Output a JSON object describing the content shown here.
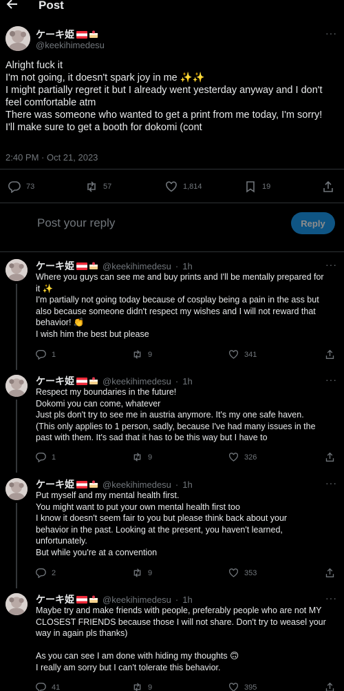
{
  "header": {
    "title": "Post"
  },
  "main": {
    "display_name": "ケーキ姫",
    "handle": "@keekihimedesu",
    "lines": [
      "Alright fuck it",
      "I'm not going, it doesn't spark joy in me ✨✨",
      "I might partially regret it but I already went yesterday anyway and I don't",
      "feel comfortable atm",
      "There was someone who wanted to get a print from me today, I'm sorry!",
      "I'll make sure to get a booth for dokomi (cont"
    ],
    "timestamp": "2:40 PM · Oct 21, 2023",
    "replies": "73",
    "reposts": "57",
    "likes": "1,814",
    "bookmarks": "19"
  },
  "reply_box": {
    "placeholder": "Post your reply",
    "button": "Reply"
  },
  "thread": [
    {
      "display_name": "ケーキ姫",
      "handle": "@keekihimedesu",
      "time": "1h",
      "lines": [
        "Where you guys can see me and buy prints and I'll be mentally prepared for",
        "it ✨",
        "I'm partially not going today because of cosplay being a pain in the ass but",
        "also because someone didn't respect my wishes and I will not reward that",
        "behavior! 👏",
        "I wish him the best but please"
      ],
      "replies": "1",
      "reposts": "9",
      "likes": "341"
    },
    {
      "display_name": "ケーキ姫",
      "handle": "@keekihimedesu",
      "time": "1h",
      "lines": [
        "Respect my boundaries in the future!",
        "Dokomi you can come, whatever",
        "Just pls don't try to see me in austria anymore. It's my one safe haven.",
        "(This only applies to 1 person, sadly, because I've had many issues in the",
        "past with them. It's sad that it has to be this way but I have to"
      ],
      "replies": "1",
      "reposts": "9",
      "likes": "326"
    },
    {
      "display_name": "ケーキ姫",
      "handle": "@keekihimedesu",
      "time": "1h",
      "lines": [
        "Put myself and my mental health first.",
        "You might want to put your own mental health first too",
        "I know it doesn't seem fair to you but please think back about your",
        "behavior in the past. Looking at the present, you haven't learned,",
        "unfortunately.",
        "But while you're at a convention"
      ],
      "replies": "2",
      "reposts": "9",
      "likes": "353"
    },
    {
      "display_name": "ケーキ姫",
      "handle": "@keekihimedesu",
      "time": "1h",
      "lines": [
        "Maybe try and make friends with people, preferably people who are not MY",
        "CLOSEST FRIENDS because those I will not share. Don't try to weasel your",
        "way in again pls thanks)",
        "",
        "As you can see I am done with hiding my thoughts 🙃",
        "I really am sorry but I can't tolerate this behavior."
      ],
      "replies": "41",
      "reposts": "9",
      "likes": "395"
    }
  ]
}
